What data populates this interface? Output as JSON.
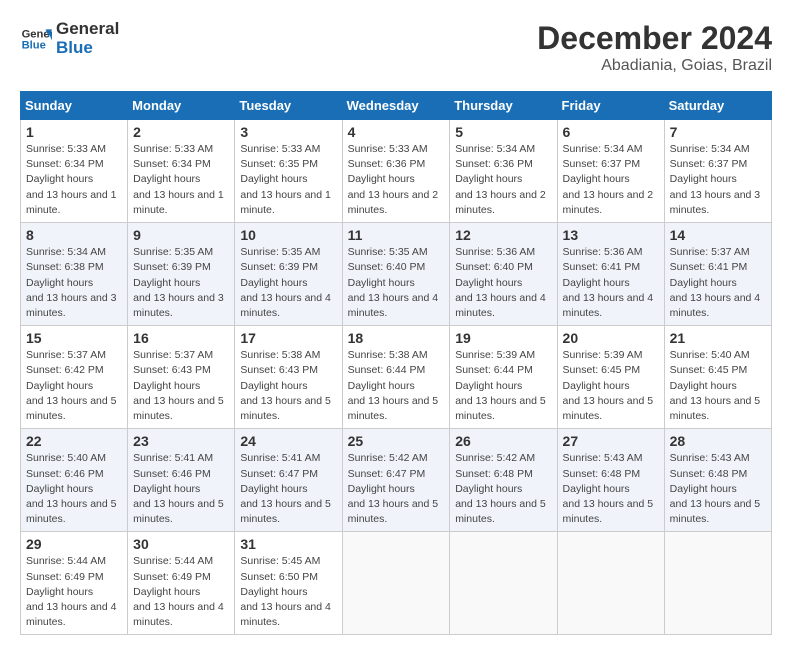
{
  "header": {
    "logo_line1": "General",
    "logo_line2": "Blue",
    "month_year": "December 2024",
    "location": "Abadiania, Goias, Brazil"
  },
  "days_of_week": [
    "Sunday",
    "Monday",
    "Tuesday",
    "Wednesday",
    "Thursday",
    "Friday",
    "Saturday"
  ],
  "weeks": [
    [
      {
        "day": 1,
        "sunrise": "5:33 AM",
        "sunset": "6:34 PM",
        "daylight": "13 hours and 1 minute."
      },
      {
        "day": 2,
        "sunrise": "5:33 AM",
        "sunset": "6:34 PM",
        "daylight": "13 hours and 1 minute."
      },
      {
        "day": 3,
        "sunrise": "5:33 AM",
        "sunset": "6:35 PM",
        "daylight": "13 hours and 1 minute."
      },
      {
        "day": 4,
        "sunrise": "5:33 AM",
        "sunset": "6:36 PM",
        "daylight": "13 hours and 2 minutes."
      },
      {
        "day": 5,
        "sunrise": "5:34 AM",
        "sunset": "6:36 PM",
        "daylight": "13 hours and 2 minutes."
      },
      {
        "day": 6,
        "sunrise": "5:34 AM",
        "sunset": "6:37 PM",
        "daylight": "13 hours and 2 minutes."
      },
      {
        "day": 7,
        "sunrise": "5:34 AM",
        "sunset": "6:37 PM",
        "daylight": "13 hours and 3 minutes."
      }
    ],
    [
      {
        "day": 8,
        "sunrise": "5:34 AM",
        "sunset": "6:38 PM",
        "daylight": "13 hours and 3 minutes."
      },
      {
        "day": 9,
        "sunrise": "5:35 AM",
        "sunset": "6:39 PM",
        "daylight": "13 hours and 3 minutes."
      },
      {
        "day": 10,
        "sunrise": "5:35 AM",
        "sunset": "6:39 PM",
        "daylight": "13 hours and 4 minutes."
      },
      {
        "day": 11,
        "sunrise": "5:35 AM",
        "sunset": "6:40 PM",
        "daylight": "13 hours and 4 minutes."
      },
      {
        "day": 12,
        "sunrise": "5:36 AM",
        "sunset": "6:40 PM",
        "daylight": "13 hours and 4 minutes."
      },
      {
        "day": 13,
        "sunrise": "5:36 AM",
        "sunset": "6:41 PM",
        "daylight": "13 hours and 4 minutes."
      },
      {
        "day": 14,
        "sunrise": "5:37 AM",
        "sunset": "6:41 PM",
        "daylight": "13 hours and 4 minutes."
      }
    ],
    [
      {
        "day": 15,
        "sunrise": "5:37 AM",
        "sunset": "6:42 PM",
        "daylight": "13 hours and 5 minutes."
      },
      {
        "day": 16,
        "sunrise": "5:37 AM",
        "sunset": "6:43 PM",
        "daylight": "13 hours and 5 minutes."
      },
      {
        "day": 17,
        "sunrise": "5:38 AM",
        "sunset": "6:43 PM",
        "daylight": "13 hours and 5 minutes."
      },
      {
        "day": 18,
        "sunrise": "5:38 AM",
        "sunset": "6:44 PM",
        "daylight": "13 hours and 5 minutes."
      },
      {
        "day": 19,
        "sunrise": "5:39 AM",
        "sunset": "6:44 PM",
        "daylight": "13 hours and 5 minutes."
      },
      {
        "day": 20,
        "sunrise": "5:39 AM",
        "sunset": "6:45 PM",
        "daylight": "13 hours and 5 minutes."
      },
      {
        "day": 21,
        "sunrise": "5:40 AM",
        "sunset": "6:45 PM",
        "daylight": "13 hours and 5 minutes."
      }
    ],
    [
      {
        "day": 22,
        "sunrise": "5:40 AM",
        "sunset": "6:46 PM",
        "daylight": "13 hours and 5 minutes."
      },
      {
        "day": 23,
        "sunrise": "5:41 AM",
        "sunset": "6:46 PM",
        "daylight": "13 hours and 5 minutes."
      },
      {
        "day": 24,
        "sunrise": "5:41 AM",
        "sunset": "6:47 PM",
        "daylight": "13 hours and 5 minutes."
      },
      {
        "day": 25,
        "sunrise": "5:42 AM",
        "sunset": "6:47 PM",
        "daylight": "13 hours and 5 minutes."
      },
      {
        "day": 26,
        "sunrise": "5:42 AM",
        "sunset": "6:48 PM",
        "daylight": "13 hours and 5 minutes."
      },
      {
        "day": 27,
        "sunrise": "5:43 AM",
        "sunset": "6:48 PM",
        "daylight": "13 hours and 5 minutes."
      },
      {
        "day": 28,
        "sunrise": "5:43 AM",
        "sunset": "6:48 PM",
        "daylight": "13 hours and 5 minutes."
      }
    ],
    [
      {
        "day": 29,
        "sunrise": "5:44 AM",
        "sunset": "6:49 PM",
        "daylight": "13 hours and 4 minutes."
      },
      {
        "day": 30,
        "sunrise": "5:44 AM",
        "sunset": "6:49 PM",
        "daylight": "13 hours and 4 minutes."
      },
      {
        "day": 31,
        "sunrise": "5:45 AM",
        "sunset": "6:50 PM",
        "daylight": "13 hours and 4 minutes."
      },
      null,
      null,
      null,
      null
    ]
  ]
}
